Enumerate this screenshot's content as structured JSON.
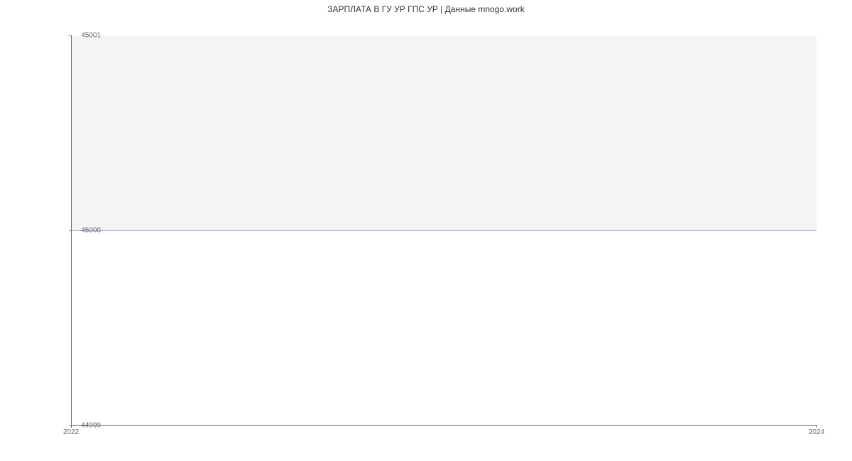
{
  "chart_data": {
    "type": "line",
    "title": "ЗАРПЛАТА В ГУ УР ГПС УР | Данные mnogo.work",
    "x": [
      2022,
      2024
    ],
    "values": [
      45000,
      45000
    ],
    "xlabel": "",
    "ylabel": "",
    "xlim": [
      2022,
      2024
    ],
    "ylim": [
      44999,
      45001
    ],
    "y_ticks": [
      44999,
      45000,
      45001
    ],
    "x_ticks": [
      2022,
      2024
    ],
    "line_color": "#6699e8",
    "alt_band_color": "#f4f4f4"
  }
}
